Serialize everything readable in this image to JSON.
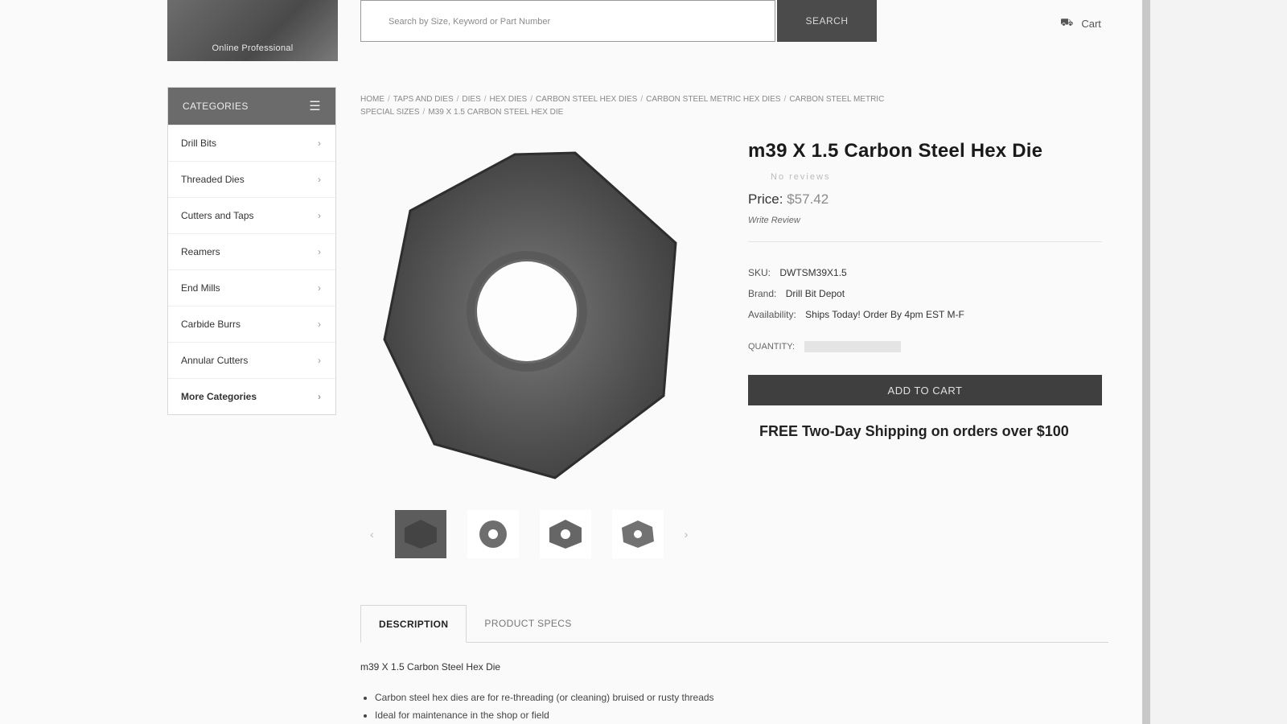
{
  "header": {
    "logo_text": "Online Professional",
    "search_placeholder": "Search by Size, Keyword or Part Number",
    "search_button": "SEARCH",
    "cart_label": "Cart"
  },
  "sidebar": {
    "title": "CATEGORIES",
    "items": [
      {
        "label": "Drill Bits"
      },
      {
        "label": "Threaded Dies"
      },
      {
        "label": "Cutters and Taps"
      },
      {
        "label": "Reamers"
      },
      {
        "label": "End Mills"
      },
      {
        "label": "Carbide Burrs"
      },
      {
        "label": "Annular Cutters"
      },
      {
        "label": "More Categories"
      }
    ]
  },
  "breadcrumb": [
    "HOME",
    "TAPS AND DIES",
    "DIES",
    "HEX DIES",
    "CARBON STEEL HEX DIES",
    "CARBON STEEL METRIC HEX DIES",
    "CARBON STEEL METRIC SPECIAL SIZES",
    "M39 X 1.5 CARBON STEEL HEX DIE"
  ],
  "product": {
    "title": "m39 X 1.5 Carbon Steel Hex Die",
    "reviews_text": "No reviews",
    "price_label": "Price:",
    "price": "$57.42",
    "review_link": "Write Review",
    "sku_label": "SKU:",
    "sku": "DWTSM39X1.5",
    "brand_label": "Brand:",
    "brand": "Drill Bit Depot",
    "availability_label": "Availability:",
    "availability": "Ships Today! Order By 4pm EST M-F",
    "quantity_label": "QUANTITY:",
    "add_to_cart": "ADD TO CART",
    "shipping_note": "FREE Two-Day Shipping on orders over $100"
  },
  "tabs": [
    {
      "label": "DESCRIPTION",
      "active": true
    },
    {
      "label": "PRODUCT SPECS",
      "active": false
    }
  ],
  "description": {
    "title": "m39 X 1.5 Carbon Steel Hex Die",
    "bullets": [
      "Carbon steel hex dies are for re-threading (or cleaning) bruised or rusty threads",
      "Ideal for maintenance in the shop or field"
    ]
  },
  "colors": {
    "header_dark": "#4b4b4b",
    "sidebar_header": "#6b6b6b",
    "button_dark": "#3f3f3f"
  }
}
